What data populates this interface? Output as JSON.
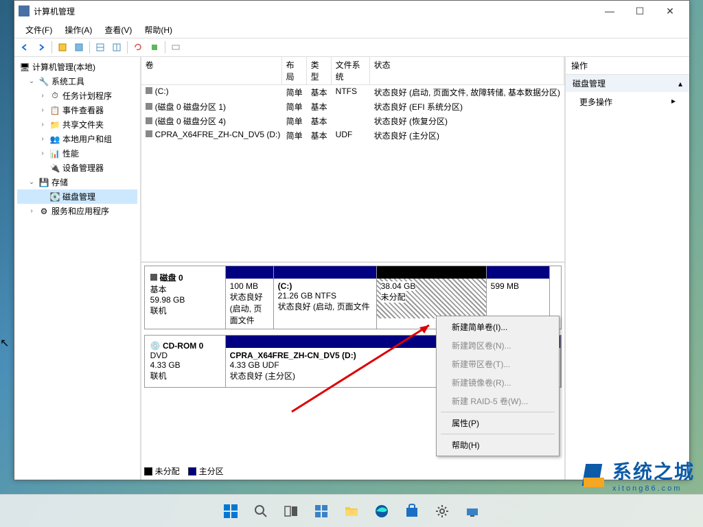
{
  "window": {
    "title": "计算机管理",
    "min": "—",
    "max": "☐",
    "close": "✕"
  },
  "menu": {
    "file": "文件(F)",
    "action": "操作(A)",
    "view": "查看(V)",
    "help": "帮助(H)"
  },
  "tree": {
    "root": "计算机管理(本地)",
    "system_tools": "系统工具",
    "task_scheduler": "任务计划程序",
    "event_viewer": "事件查看器",
    "shared_folders": "共享文件夹",
    "local_users": "本地用户和组",
    "performance": "性能",
    "device_manager": "设备管理器",
    "storage": "存储",
    "disk_mgmt": "磁盘管理",
    "services": "服务和应用程序"
  },
  "vol_headers": {
    "volume": "卷",
    "layout": "布局",
    "type": "类型",
    "fs": "文件系统",
    "status": "状态"
  },
  "volumes": [
    {
      "name": "(C:)",
      "layout": "简单",
      "type": "基本",
      "fs": "NTFS",
      "status": "状态良好 (启动, 页面文件, 故障转储, 基本数据分区)"
    },
    {
      "name": "(磁盘 0 磁盘分区 1)",
      "layout": "简单",
      "type": "基本",
      "fs": "",
      "status": "状态良好 (EFI 系统分区)"
    },
    {
      "name": "(磁盘 0 磁盘分区 4)",
      "layout": "简单",
      "type": "基本",
      "fs": "",
      "status": "状态良好 (恢复分区)"
    },
    {
      "name": "CPRA_X64FRE_ZH-CN_DV5 (D:)",
      "layout": "简单",
      "type": "基本",
      "fs": "UDF",
      "status": "状态良好 (主分区)"
    }
  ],
  "disk0": {
    "name": "磁盘 0",
    "type": "基本",
    "size": "59.98 GB",
    "status": "联机",
    "p1": {
      "size": "100 MB",
      "status": "状态良好 (启动, 页面文件"
    },
    "p2": {
      "name": "(C:)",
      "size": "21.26 GB NTFS",
      "status": "状态良好 (启动, 页面文件"
    },
    "p3": {
      "size": "38.04 GB",
      "status": "未分配"
    },
    "p4": {
      "size": "599 MB"
    }
  },
  "cdrom": {
    "name": "CD-ROM 0",
    "type": "DVD",
    "size": "4.33 GB",
    "status": "联机",
    "p1": {
      "name": "CPRA_X64FRE_ZH-CN_DV5  (D:)",
      "size": "4.33 GB UDF",
      "status": "状态良好 (主分区)"
    }
  },
  "legend": {
    "unalloc": "未分配",
    "primary": "主分区"
  },
  "actions": {
    "header": "操作",
    "section": "磁盘管理",
    "more": "更多操作"
  },
  "ctx": {
    "simple": "新建简单卷(I)...",
    "span": "新建跨区卷(N)...",
    "stripe": "新建带区卷(T)...",
    "mirror": "新建镜像卷(R)...",
    "raid5": "新建 RAID-5 卷(W)...",
    "props": "属性(P)",
    "help": "帮助(H)"
  },
  "watermark": {
    "brand": "系统之城",
    "url": "xitong86.com"
  }
}
